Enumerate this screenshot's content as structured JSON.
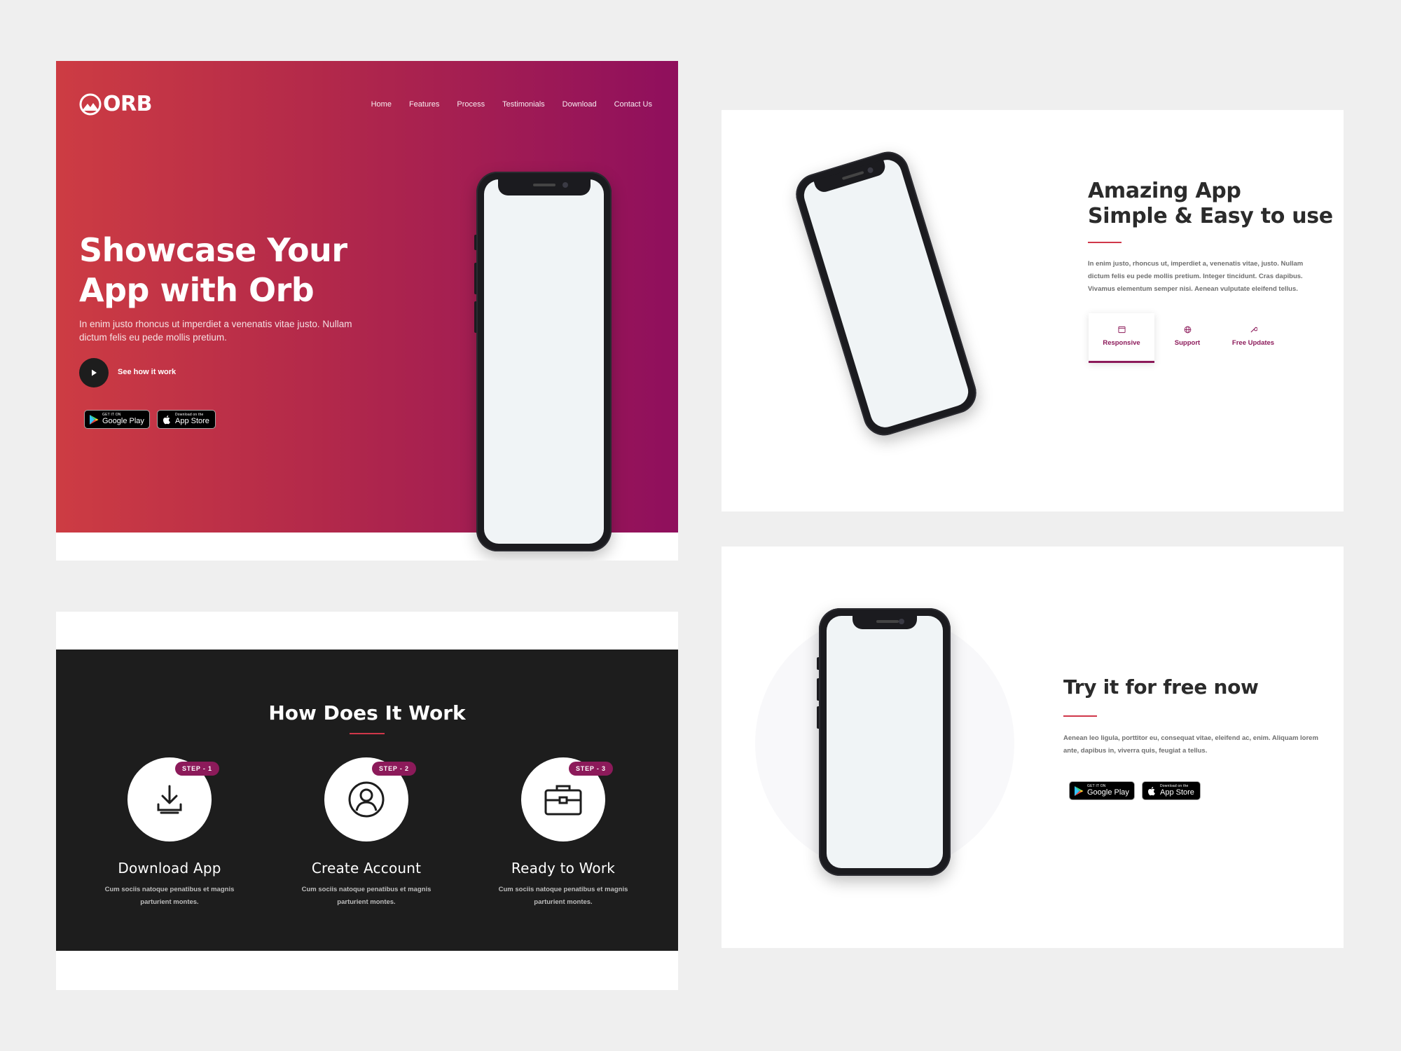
{
  "hero": {
    "logo_text": "ORB",
    "nav": [
      "Home",
      "Features",
      "Process",
      "Testimonials",
      "Download",
      "Contact Us"
    ],
    "title": "Showcase Your App with Orb",
    "subtitle": "In enim justo rhoncus ut imperdiet a venenatis vitae justo. Nullam dictum felis eu pede mollis pretium.",
    "play_label": "See how it work",
    "gradient": [
      "#cd3c43",
      "#8f0f5d"
    ]
  },
  "stores": {
    "google_small": "GET IT ON",
    "google_big": "Google Play",
    "apple_small": "Download on the",
    "apple_big": "App Store"
  },
  "features": {
    "title_line1": "Amazing App",
    "title_line2": "Simple & Easy to use",
    "body": "In enim justo, rhoncus ut, imperdiet a, venenatis vitae, justo. Nullam dictum felis eu pede mollis pretium. Integer tincidunt. Cras dapibus. Vivamus elementum semper nisi. Aenean vulputate eleifend tellus.",
    "tabs": [
      {
        "label": "Responsive",
        "icon": "browser-icon",
        "active": true
      },
      {
        "label": "Support",
        "icon": "globe-icon",
        "active": false
      },
      {
        "label": "Free Updates",
        "icon": "wrench-icon",
        "active": false
      }
    ]
  },
  "how": {
    "title": "How Does It Work",
    "steps": [
      {
        "badge": "STEP - 1",
        "title": "Download App",
        "desc": "Cum sociis natoque penatibus et magnis parturient montes.",
        "icon": "download-icon"
      },
      {
        "badge": "STEP - 2",
        "title": "Create Account",
        "desc": "Cum sociis natoque penatibus et magnis parturient montes.",
        "icon": "user-icon"
      },
      {
        "badge": "STEP - 3",
        "title": "Ready to Work",
        "desc": "Cum sociis natoque penatibus et magnis parturient montes.",
        "icon": "briefcase-icon"
      }
    ]
  },
  "cta": {
    "title": "Try it for free now",
    "body": "Aenean leo ligula, porttitor eu, consequat vitae, eleifend ac, enim. Aliquam lorem ante, dapibus in, viverra quis, feugiat a tellus."
  },
  "colors": {
    "accent": "#8c1a5a",
    "divider": "#d0374a",
    "dark": "#1d1d1d",
    "page_bg": "#efefef"
  }
}
